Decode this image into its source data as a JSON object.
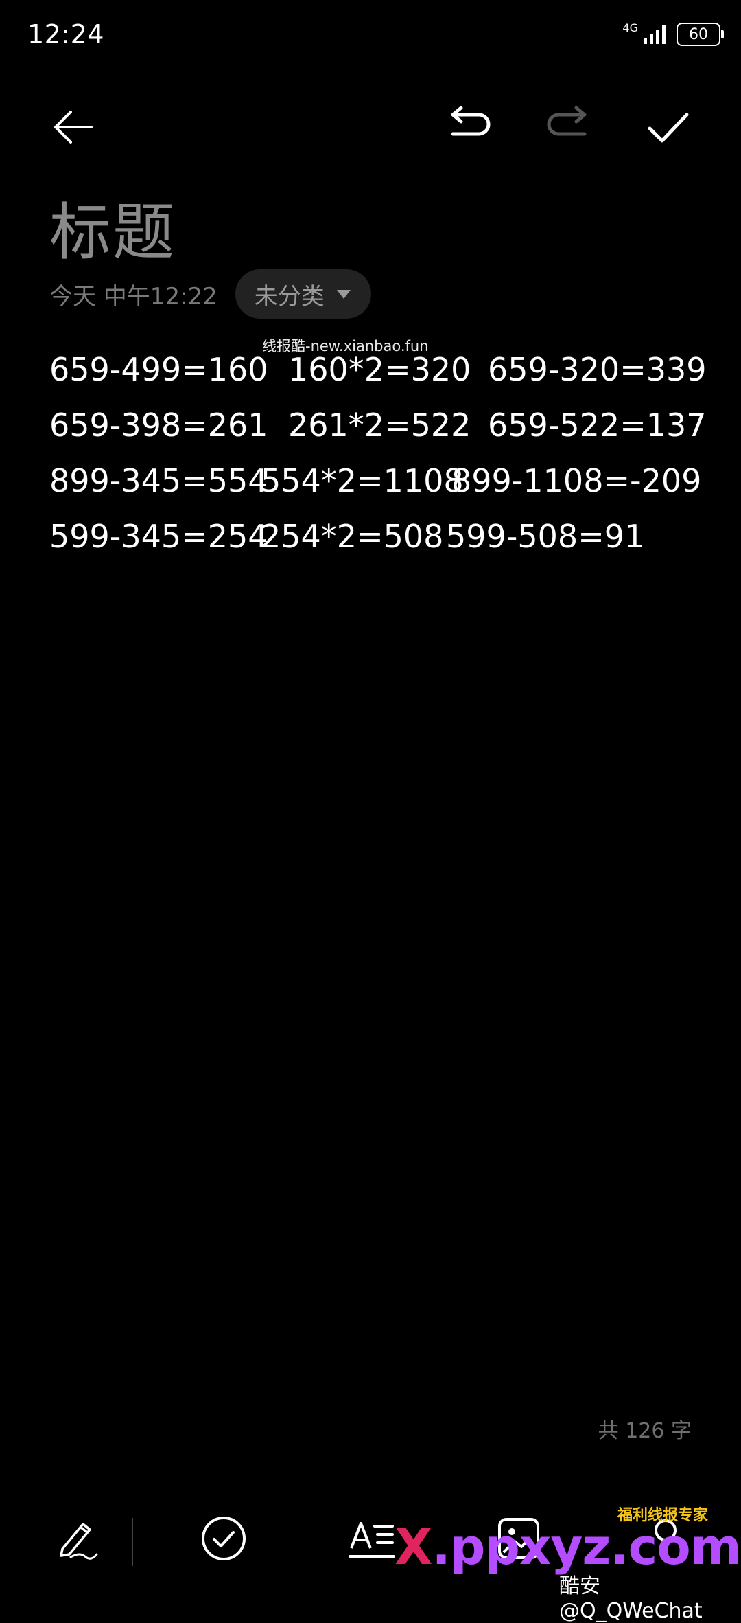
{
  "status_bar": {
    "time": "12:24",
    "network": "4G",
    "battery": "60"
  },
  "toolbar": {
    "back_icon": "arrow-left-icon",
    "undo_icon": "undo-icon",
    "redo_icon": "redo-icon",
    "done_icon": "check-icon"
  },
  "note": {
    "title": "标题",
    "date": "今天 中午12:22",
    "category": "未分类",
    "lines": [
      [
        "659-499=160",
        "160*2=320",
        "659-320=339"
      ],
      [
        "659-398=261",
        "261*2=522",
        "659-522=137"
      ],
      [
        "899-345=554",
        "554*2=1108",
        "899-1108=-209"
      ],
      [
        "599-345=254",
        "254*2=508",
        "599-508=91"
      ]
    ],
    "char_count": "共 126 字"
  },
  "bottom_bar": {
    "items": [
      {
        "name": "handwriting-icon"
      },
      {
        "name": "checklist-icon"
      },
      {
        "name": "text-format-icon"
      },
      {
        "name": "image-icon"
      },
      {
        "name": "more-icon"
      }
    ]
  },
  "watermarks": {
    "top": "线报酷-new.xianbao.fun",
    "brand_x": "X",
    "brand_rest": ".ppxyz.com",
    "small": "福利线报专家",
    "coolapk": "酷安@Q_QWeChat"
  },
  "colors": {
    "background": "#000000",
    "text": "#ffffff",
    "muted": "#8a8a8a",
    "pill": "#222222"
  }
}
